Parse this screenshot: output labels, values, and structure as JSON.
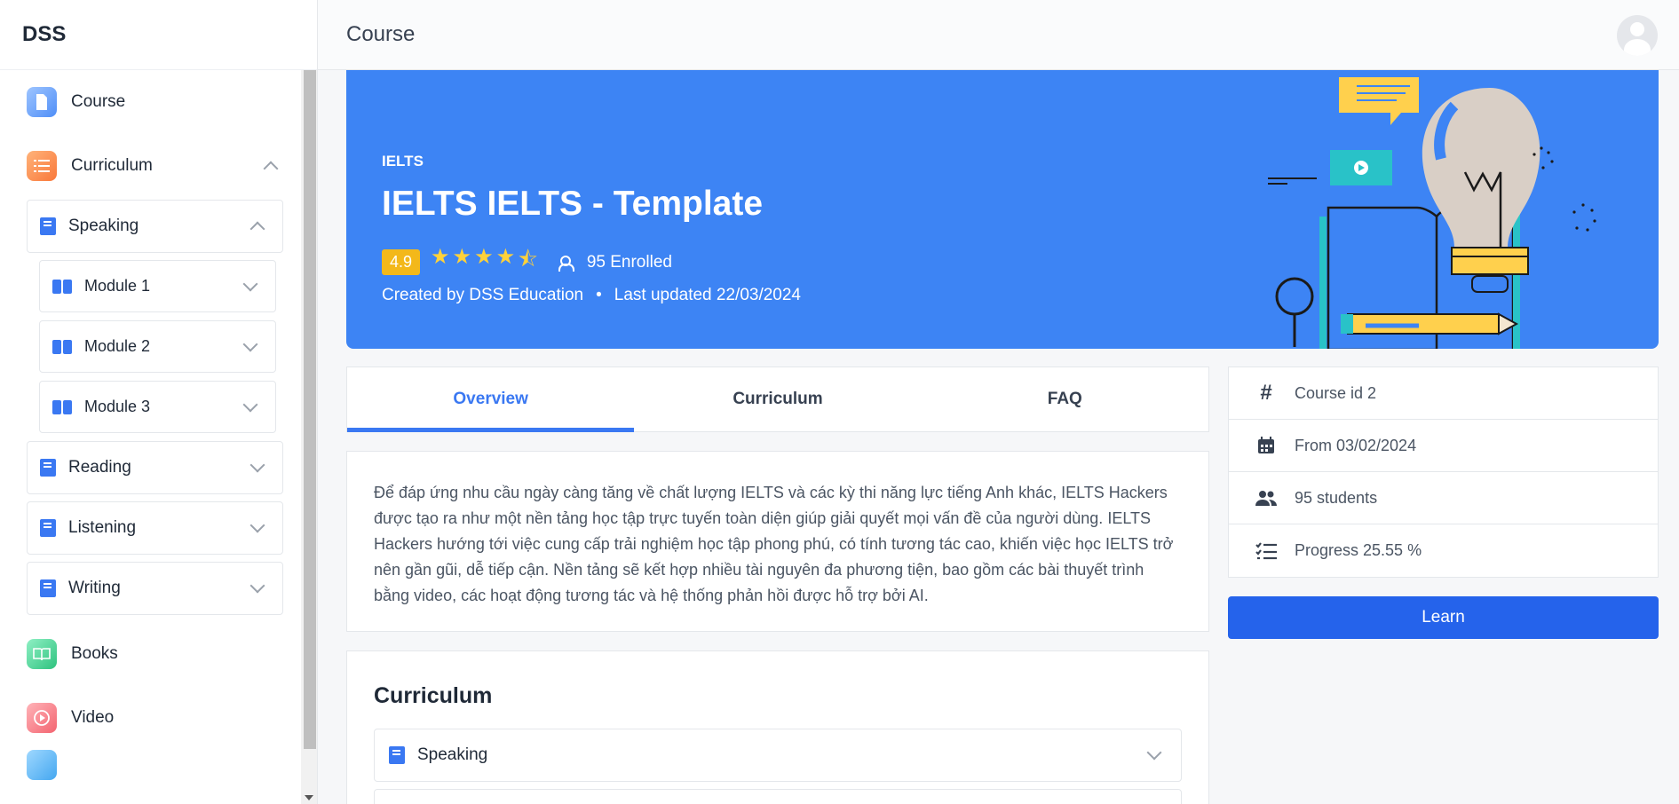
{
  "brand": "DSS",
  "header": {
    "title": "Course"
  },
  "sidebar": {
    "course": "Course",
    "curriculum": "Curriculum",
    "speaking": "Speaking",
    "modules": [
      "Module 1",
      "Module 2",
      "Module 3"
    ],
    "reading": "Reading",
    "listening": "Listening",
    "writing": "Writing",
    "books": "Books",
    "video": "Video"
  },
  "hero": {
    "category": "IELTS",
    "title": "IELTS IELTS - Template",
    "rating": "4.9",
    "stars_value": 4.5,
    "enrolled": "95 Enrolled",
    "created_prefix": "Created by",
    "author": "DSS Education",
    "separator": "•",
    "updated": "Last updated 22/03/2024"
  },
  "tabs": [
    "Overview",
    "Curriculum",
    "FAQ"
  ],
  "description": "Để đáp ứng nhu cầu ngày càng tăng về chất lượng IELTS và các kỳ thi năng lực tiếng Anh khác, IELTS Hackers được tạo ra như một nền tảng học tập trực tuyến toàn diện giúp giải quyết mọi vấn đề của người dùng. IELTS Hackers hướng tới việc cung cấp trải nghiệm học tập phong phú, có tính tương tác cao, khiến việc học IELTS trở nên gần gũi, dễ tiếp cận. Nền tảng sẽ kết hợp nhiều tài nguyên đa phương tiện, bao gồm các bài thuyết trình bằng video, các hoạt động tương tác và hệ thống phản hồi được hỗ trợ bởi AI.",
  "curriculum": {
    "heading": "Curriculum",
    "item": "Speaking"
  },
  "info": {
    "course_id": "Course id 2",
    "from": "From 03/02/2024",
    "students": "95 students",
    "progress": "Progress 25.55 %"
  },
  "learn_label": "Learn"
}
